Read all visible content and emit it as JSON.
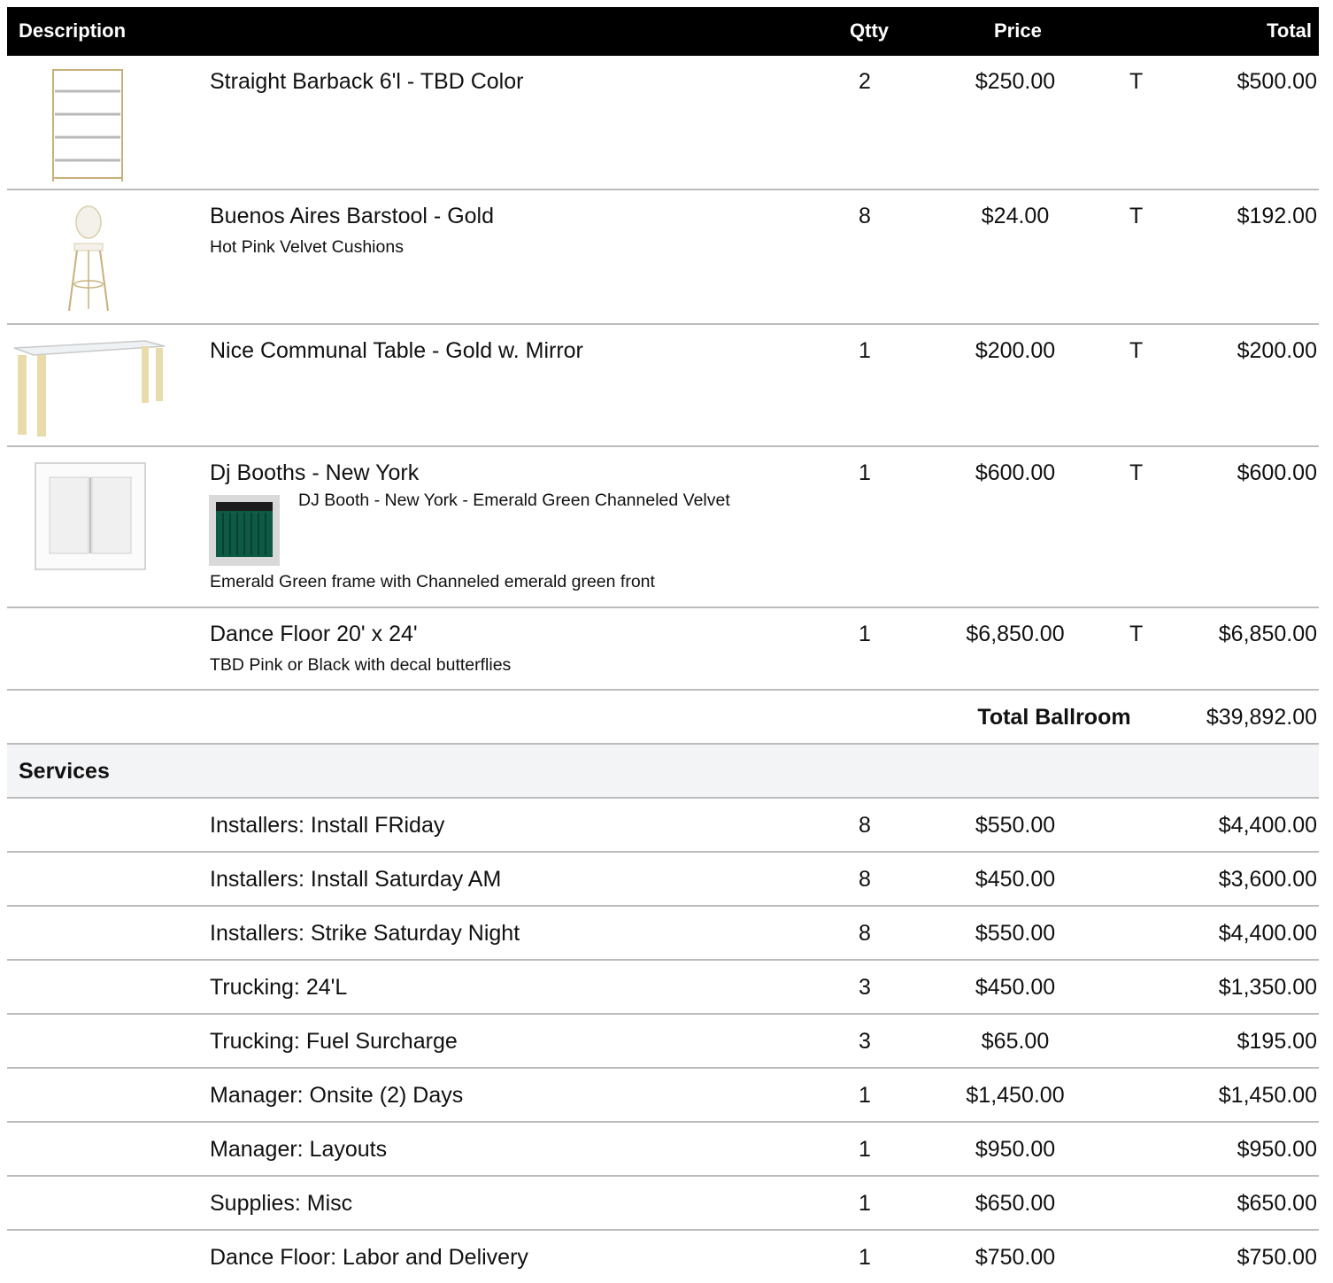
{
  "header": {
    "description": "Description",
    "qty": "Qtty",
    "price": "Price",
    "total": "Total"
  },
  "items": [
    {
      "name": "Straight Barback 6'l - TBD Color",
      "qty": "2",
      "price": "$250.00",
      "tax": "T",
      "total": "$500.00",
      "icon": "shelf-image"
    },
    {
      "name": "Buenos Aires Barstool - Gold",
      "note": "Hot Pink Velvet Cushions",
      "qty": "8",
      "price": "$24.00",
      "tax": "T",
      "total": "$192.00",
      "icon": "barstool-image"
    },
    {
      "name": "Nice Communal Table  - Gold w. Mirror",
      "qty": "1",
      "price": "$200.00",
      "tax": "T",
      "total": "$200.00",
      "icon": "table-image"
    },
    {
      "name": "Dj Booths - New York",
      "sub_note": "DJ Booth - New York - Emerald Green Channeled Velvet",
      "note": "Emerald Green frame with Channeled emerald green front",
      "qty": "1",
      "price": "$600.00",
      "tax": "T",
      "total": "$600.00",
      "icon": "dj-booth-image"
    },
    {
      "name": "Dance Floor 20' x 24'",
      "note": "TBD Pink or Black with decal butterflies",
      "qty": "1",
      "price": "$6,850.00",
      "tax": "T",
      "total": "$6,850.00"
    }
  ],
  "subtotal": {
    "label": "Total Ballroom",
    "value": "$39,892.00"
  },
  "services_section": {
    "title": "Services"
  },
  "services": [
    {
      "name": "Installers: Install FRiday",
      "qty": "8",
      "price": "$550.00",
      "total": "$4,400.00"
    },
    {
      "name": "Installers: Install Saturday AM",
      "qty": "8",
      "price": "$450.00",
      "total": "$3,600.00"
    },
    {
      "name": "Installers: Strike Saturday Night",
      "qty": "8",
      "price": "$550.00",
      "total": "$4,400.00"
    },
    {
      "name": "Trucking: 24'L",
      "qty": "3",
      "price": "$450.00",
      "total": "$1,350.00"
    },
    {
      "name": "Trucking: Fuel Surcharge",
      "qty": "3",
      "price": "$65.00",
      "total": "$195.00"
    },
    {
      "name": "Manager: Onsite (2) Days",
      "qty": "1",
      "price": "$1,450.00",
      "total": "$1,450.00"
    },
    {
      "name": "Manager: Layouts",
      "qty": "1",
      "price": "$950.00",
      "total": "$950.00"
    },
    {
      "name": "Supplies: Misc",
      "qty": "1",
      "price": "$650.00",
      "total": "$650.00"
    },
    {
      "name": "Dance Floor: Labor and Delivery",
      "qty": "1",
      "price": "$750.00",
      "total": "$750.00"
    }
  ]
}
